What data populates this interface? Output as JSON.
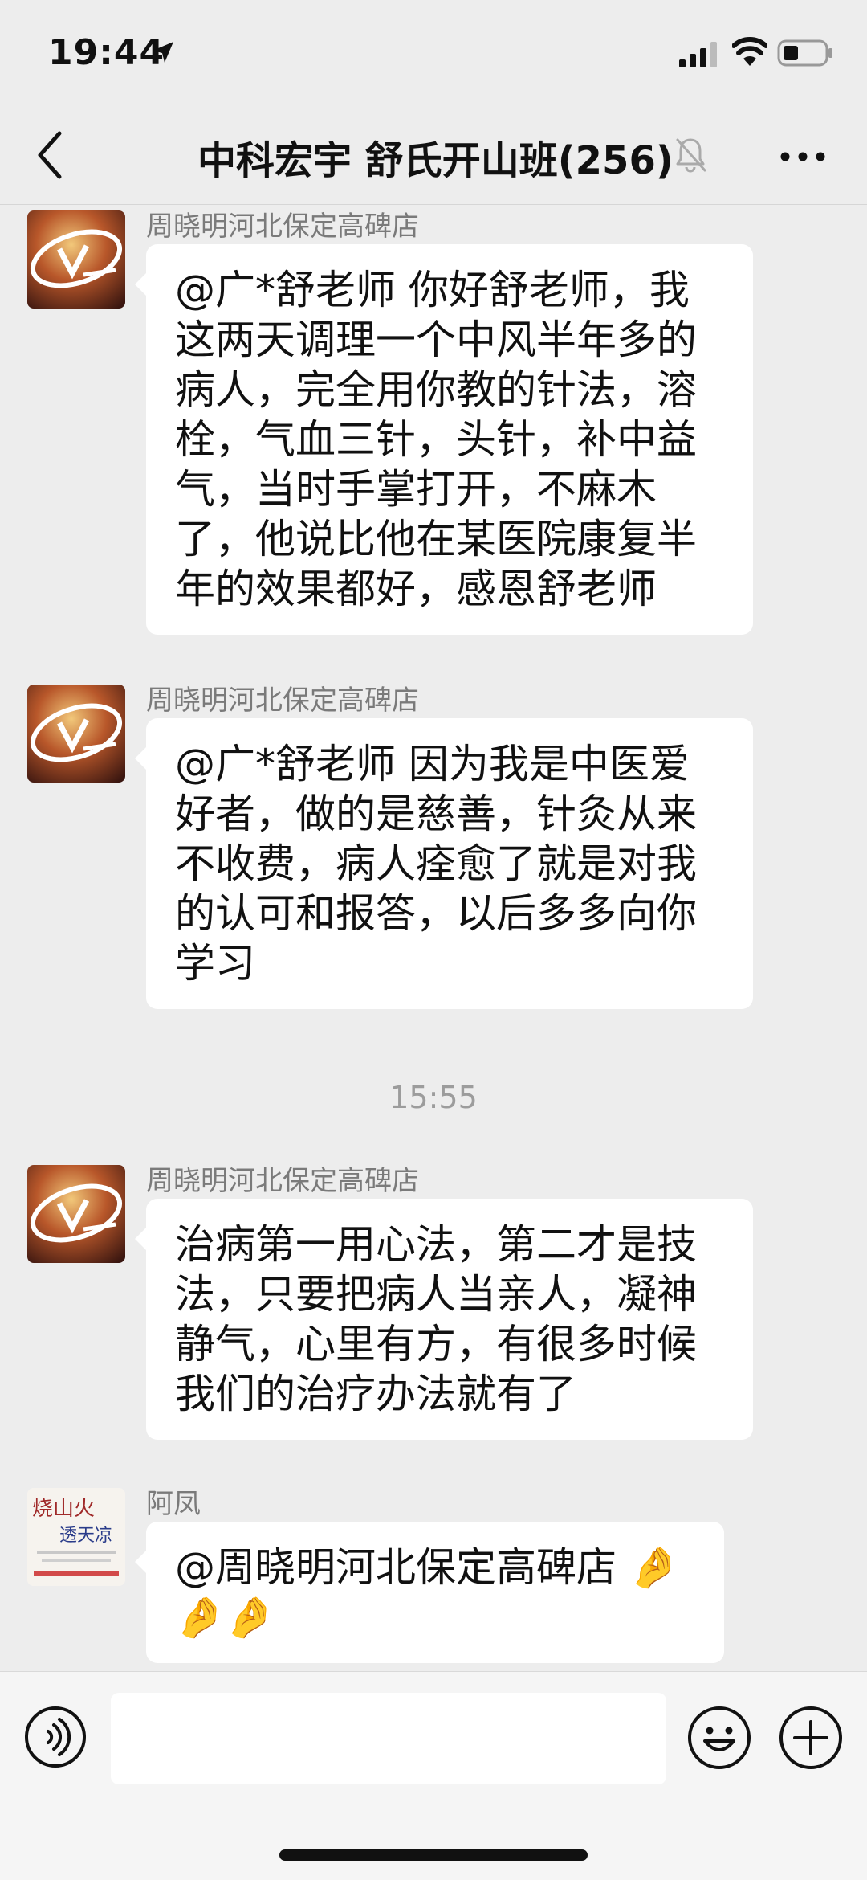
{
  "status_bar": {
    "time": "19:44",
    "location_icon": "location-arrow-icon",
    "signal_icon": "cellular-signal-icon",
    "wifi_icon": "wifi-icon",
    "battery_icon": "battery-icon"
  },
  "nav": {
    "back_icon": "chevron-left-icon",
    "title": "中科宏宇 舒氏开山班(256)",
    "mute_icon": "muted-bell-icon",
    "more_icon": "more-dots-icon"
  },
  "messages": [
    {
      "sender": "周晓明河北保定高碑店",
      "lines": [
        "@广*舒老师 你好舒老师，我",
        "这两天调理一个中风半年多的",
        "病人，完全用你教的针法，溶",
        "栓，气血三针，头针，补中益",
        "气，当时手掌打开，不麻木",
        "了，他说比他在某医院康复半",
        "年的效果都好，感恩舒老师"
      ]
    },
    {
      "sender": "周晓明河北保定高碑店",
      "lines": [
        "@广*舒老师 因为我是中医爱",
        "好者，做的是慈善，针灸从来",
        "不收费，病人痊愈了就是对我",
        "的认可和报答，以后多多向你",
        "学习"
      ]
    },
    {
      "sender": "周晓明河北保定高碑店",
      "lines": [
        "治病第一用心法，第二才是技",
        "法，只要把病人当亲人，凝神",
        "静气，心里有方，有很多时候",
        "我们的治疗办法就有了"
      ]
    },
    {
      "sender": "阿凤",
      "lines": [
        "@周晓明河北保定高碑店 🤌",
        "🤌🤌"
      ]
    }
  ],
  "timestamp": "15:55",
  "avatar2_text": {
    "line1": "烧山火",
    "line2": "透天凉"
  },
  "input_bar": {
    "voice_icon": "voice-icon",
    "input_value": "",
    "emoji_icon": "emoji-icon",
    "plus_icon": "plus-icon"
  }
}
